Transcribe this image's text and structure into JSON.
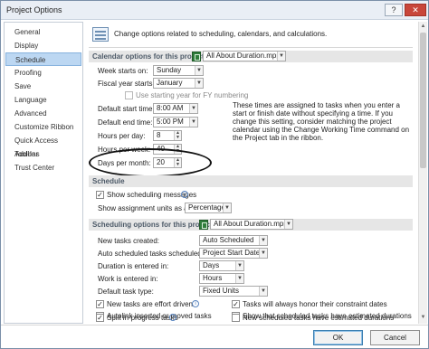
{
  "window": {
    "title": "Project Options",
    "help_label": "?",
    "close_label": "✕"
  },
  "sidebar": {
    "items": [
      {
        "label": "General"
      },
      {
        "label": "Display"
      },
      {
        "label": "Schedule"
      },
      {
        "label": "Proofing"
      },
      {
        "label": "Save"
      },
      {
        "label": "Language"
      },
      {
        "label": "Advanced"
      },
      {
        "label": "Customize Ribbon"
      },
      {
        "label": "Quick Access Toolbar"
      },
      {
        "label": "Add-Ins"
      },
      {
        "label": "Trust Center"
      }
    ],
    "selected": "Schedule"
  },
  "header": {
    "text": "Change options related to scheduling, calendars, and calculations."
  },
  "calendar": {
    "section_label": "Calendar options for this project:",
    "project": "All About Duration.mpp",
    "week_starts_label": "Week starts on:",
    "week_starts_value": "Sunday",
    "fiscal_year_label": "Fiscal year starts in:",
    "fiscal_year_value": "January",
    "fy_numbering_label": "Use starting year for FY numbering",
    "fy_numbering_checked": false,
    "default_start_label": "Default start time:",
    "default_start_value": "8:00 AM",
    "default_end_label": "Default end time:",
    "default_end_value": "5:00 PM",
    "hours_day_label": "Hours per day:",
    "hours_day_value": "8",
    "hours_week_label": "Hours per week:",
    "hours_week_value": "40",
    "days_month_label": "Days per month:",
    "days_month_value": "20",
    "note": "These times are assigned to tasks when you enter a start or finish date without specifying a time. If you change this setting, consider matching the project calendar using the Change Working Time command on the Project tab in the ribbon."
  },
  "schedule": {
    "section_label": "Schedule",
    "show_messages_label": "Show scheduling messages",
    "show_messages_checked": true,
    "assignment_units_label": "Show assignment units as a:",
    "assignment_units_value": "Percentage"
  },
  "scheduling": {
    "section_label": "Scheduling options for this project:",
    "project": "All About Duration.mpp",
    "new_tasks_label": "New tasks created:",
    "new_tasks_value": "Auto Scheduled",
    "auto_sched_label": "Auto scheduled tasks scheduled on:",
    "auto_sched_value": "Project Start Date",
    "duration_label": "Duration is entered in:",
    "duration_value": "Days",
    "work_label": "Work is entered in:",
    "work_value": "Hours",
    "task_type_label": "Default task type:",
    "task_type_value": "Fixed Units",
    "checks": [
      {
        "label": "New tasks are effort driven",
        "checked": true
      },
      {
        "label": "Tasks will always honor their constraint dates",
        "checked": true
      },
      {
        "label": "Autolink inserted or moved tasks",
        "checked": false
      },
      {
        "label": "Show that scheduled tasks have estimated durations",
        "checked": false
      },
      {
        "label": "Split in-progress tasks",
        "checked": true
      },
      {
        "label": "New scheduled tasks have estimated durations",
        "checked": false
      }
    ]
  },
  "footer": {
    "ok_label": "OK",
    "cancel_label": "Cancel"
  },
  "glyphs": {
    "dropdown": "▼",
    "check": "✓",
    "info": "i",
    "spin_up": "▲",
    "spin_down": "▼"
  },
  "colors": {
    "selected_bg": "#bcd7f2",
    "section_bg": "#e6e6e6",
    "close_red": "#c8463a"
  }
}
